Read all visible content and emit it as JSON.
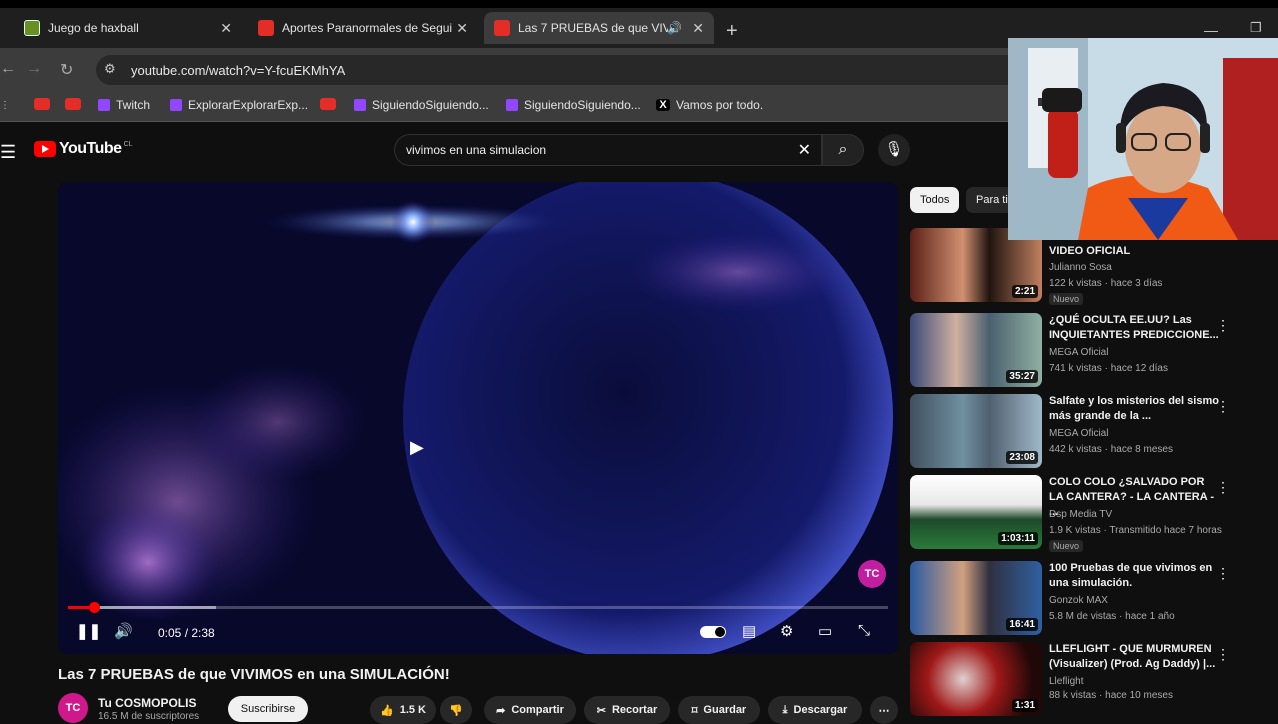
{
  "tabs": [
    {
      "title": "Juego de haxball",
      "favicon": "haxball",
      "active": false
    },
    {
      "title": "Aportes Paranormales de Segui",
      "favicon": "youtube",
      "active": false
    },
    {
      "title": "Las 7 PRUEBAS de que VIVIMOS",
      "favicon": "youtube",
      "active": true
    }
  ],
  "address": {
    "url": "youtube.com/watch?v=Y-fcuEKMhYA"
  },
  "bookmarks": [
    {
      "label": "",
      "icon": "youtube"
    },
    {
      "label": "",
      "icon": "youtube"
    },
    {
      "label": "Twitch",
      "icon": "twitch"
    },
    {
      "label": "ExplorarExplorarExp...",
      "icon": "twitch"
    },
    {
      "label": "",
      "icon": "youtube"
    },
    {
      "label": "SiguiendoSiguiendo...",
      "icon": "twitch"
    },
    {
      "label": "SiguiendoSiguiendo...",
      "icon": "twitch"
    },
    {
      "label": "Vamos por todo.",
      "icon": "x"
    }
  ],
  "youtube": {
    "logo": "YouTube",
    "region": "CL",
    "search_query": "vivimos en una simulacion"
  },
  "player": {
    "time": "0:05 / 2:38",
    "progress": 0.032,
    "buffered": 0.18,
    "watermark": "TC"
  },
  "video": {
    "title": "Las 7 PRUEBAS de que VIVIMOS en una SIMULACIÓN!",
    "channel": "Tu COSMOPOLIS",
    "subs": "16.5 M de suscriptores",
    "subscribe": "Suscribirse",
    "likes": "1.5 K",
    "share": "Compartir",
    "clip": "Recortar",
    "save": "Guardar",
    "download": "Descargar"
  },
  "chips": {
    "all": "Todos",
    "for_you": "Para ti"
  },
  "recommendations": [
    {
      "title": "VIDEO OFICIAL",
      "channel": "Julianno Sosa",
      "meta": "122 k vistas · hace 3 días",
      "duration": "2:21",
      "badge": "Nuevo",
      "thumb_colors": [
        "#6a2a2a",
        "#d8a080"
      ]
    },
    {
      "title": "¿QUÉ OCULTA EE.UU? Las INQUIETANTES PREDICCIONE...",
      "channel": "MEGA Oficial",
      "meta": "741 k vistas · hace 12 días",
      "duration": "35:27",
      "badge": "",
      "thumb_colors": [
        "#2a3a5a",
        "#8aa0c8"
      ]
    },
    {
      "title": "Salfate y los misterios del sismo más grande de la ...",
      "channel": "MEGA Oficial",
      "meta": "442 k vistas · hace 8 meses",
      "duration": "23:08",
      "badge": "",
      "thumb_colors": [
        "#3a4a5a",
        "#a0b0c0"
      ]
    },
    {
      "title": "COLO COLO ¿SALVADO POR LA CANTERA? - LA CANTERA - ...",
      "channel": "Dsp Media TV",
      "meta": "1.9 K vistas · Transmitido hace 7 horas",
      "duration": "1:03:11",
      "badge": "Nuevo",
      "thumb_colors": [
        "#1e3a2a",
        "#60a060"
      ]
    },
    {
      "title": "100 Pruebas de que vivimos en una simulación.",
      "channel": "Gonzok MAX",
      "meta": "5.8 M de vistas · hace 1 año",
      "duration": "16:41",
      "badge": "",
      "thumb_colors": [
        "#3060a0",
        "#c05050"
      ]
    },
    {
      "title": "LLEFLIGHT - QUE MURMUREN (Visualizer) (Prod. Ag Daddy) |...",
      "channel": "Lleflight",
      "meta": "88 k vistas · hace 10 meses",
      "duration": "1:31",
      "badge": "",
      "thumb_colors": [
        "#200808",
        "#a01818"
      ]
    }
  ],
  "colors": {
    "accent": "#ff0000",
    "bg": "#0f0f0f"
  }
}
